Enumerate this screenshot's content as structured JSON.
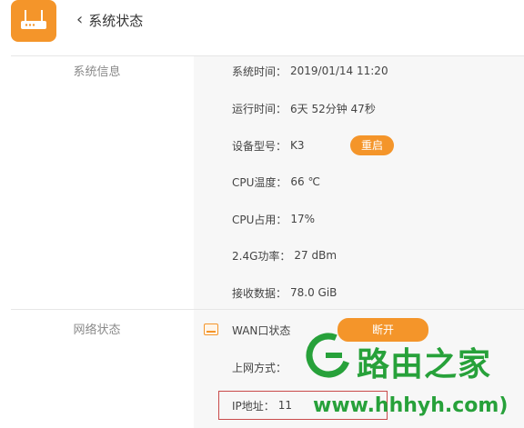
{
  "header": {
    "back_icon": "‹",
    "title": "系统状态",
    "app_icon": "router-icon",
    "accent_color": "#f4952a"
  },
  "sections": {
    "system_info_label": "系统信息",
    "network_status_label": "网络状态"
  },
  "system_info": [
    {
      "key": "系统时间：",
      "value": "2019/01/14 11:20"
    },
    {
      "key": "运行时间：",
      "value": "6天 52分钟 47秒"
    },
    {
      "key": "设备型号：",
      "value": "K3"
    },
    {
      "key": "CPU温度：",
      "value": "66 ℃"
    },
    {
      "key": "CPU占用：",
      "value": "17%"
    },
    {
      "key": "2.4G功率：",
      "value": "27 dBm"
    },
    {
      "key": "接收数据：",
      "value": "78.0 GiB"
    }
  ],
  "buttons": {
    "reboot": "重启",
    "disconnect": "断开"
  },
  "network": {
    "wan_label": "WAN口状态",
    "access_mode_key": "上网方式：",
    "ip_key": "IP地址：",
    "ip_value_partial": "11"
  },
  "watermark": {
    "brand": "路由之家",
    "url": "www.hhhyh.com)",
    "color": "#27a13a"
  }
}
